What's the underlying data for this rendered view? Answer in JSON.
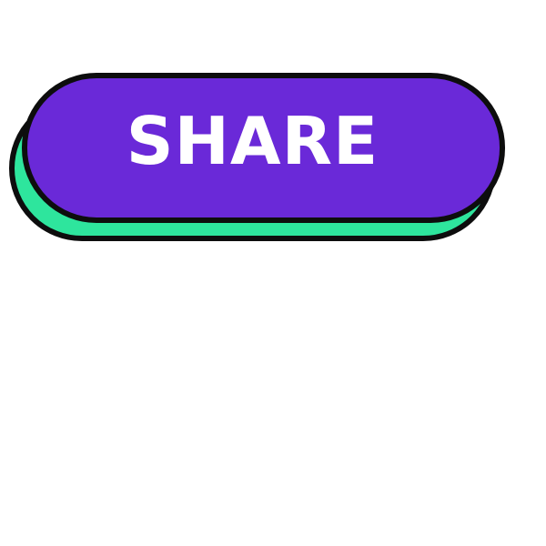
{
  "button": {
    "label": "SHARE",
    "colors": {
      "face": "#6a29d8",
      "shadow": "#2ee59d",
      "outline": "#0d0d0d",
      "text": "#ffffff"
    }
  }
}
